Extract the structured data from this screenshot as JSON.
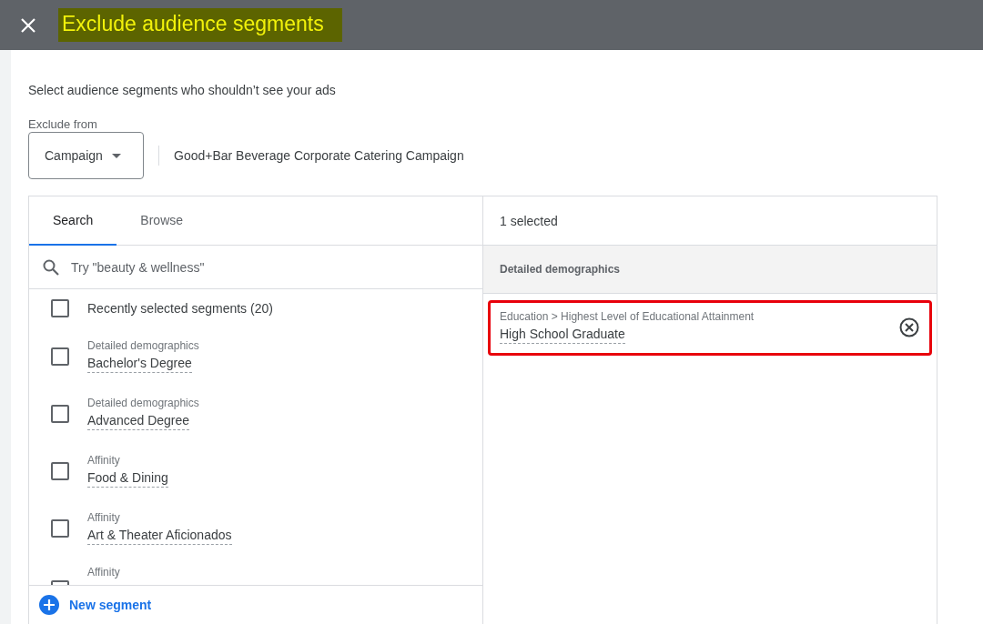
{
  "header": {
    "title": "Exclude audience segments",
    "title_highlighted": true
  },
  "description": "Select audience segments who shouldn’t see your ads",
  "exclude_from": {
    "label": "Exclude from",
    "value": "Campaign",
    "campaign_name": "Good+Bar Beverage Corporate Catering Campaign"
  },
  "tabs": [
    {
      "label": "Search",
      "selected": true
    },
    {
      "label": "Browse",
      "selected": false
    }
  ],
  "search": {
    "placeholder": "Try \"beauty & wellness\""
  },
  "segments": [
    {
      "kind": "group",
      "name": "Recently selected segments (20)",
      "checked": false
    },
    {
      "kind": "segment",
      "category": "Detailed demographics",
      "name": "Bachelor's Degree",
      "checked": false
    },
    {
      "kind": "segment",
      "category": "Detailed demographics",
      "name": "Advanced Degree",
      "checked": false
    },
    {
      "kind": "segment",
      "category": "Affinity",
      "name": "Food & Dining",
      "checked": false
    },
    {
      "kind": "segment",
      "category": "Affinity",
      "name": "Art & Theater Aficionados",
      "checked": false
    },
    {
      "kind": "segment",
      "category": "Affinity",
      "checked": false
    }
  ],
  "new_segment": "New segment",
  "selected_panel": {
    "count": "1 selected",
    "group_heading": "Detailed demographics",
    "items": [
      {
        "path": "Education > Highest Level of Educational Attainment",
        "name": "High School Graduate",
        "highlighted": true
      }
    ]
  }
}
